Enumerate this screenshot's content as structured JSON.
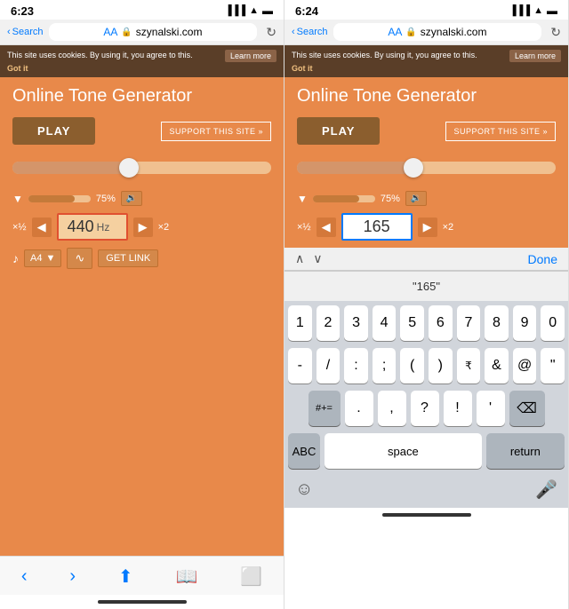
{
  "left_panel": {
    "time": "6:23",
    "back_label": "Search",
    "aa_label": "AA",
    "url": "szynalski.com",
    "cookie_text": "This site uses cookies. By using it, you agree to this.",
    "cookie_learn": "Learn more",
    "cookie_got": "Got it",
    "page_title": "Online Tone Generator",
    "play_label": "PLAY",
    "support_label": "SUPPORT THIS SITE »",
    "volume_pct": "75%",
    "freq_value": "440",
    "freq_unit": "Hz",
    "freq_half": "×½",
    "freq_double": "×2",
    "note_label": "A4",
    "get_link_label": "GET LINK"
  },
  "right_panel": {
    "time": "6:24",
    "back_label": "Search",
    "aa_label": "AA",
    "url": "szynalski.com",
    "cookie_text": "This site uses cookies. By using it, you agree to this.",
    "cookie_learn": "Learn more",
    "cookie_got": "Got it",
    "page_title": "Online Tone Generator",
    "play_label": "PLAY",
    "support_label": "SUPPORT THIS SITE »",
    "volume_pct": "75%",
    "freq_value": "165",
    "suggestion": "\"165\"",
    "done_label": "Done",
    "keyboard_rows": [
      [
        "1",
        "2",
        "3",
        "4",
        "5",
        "6",
        "7",
        "8",
        "9",
        "0"
      ],
      [
        "-",
        "/",
        ":",
        ";",
        "(",
        ")",
        "₹",
        "&",
        "@",
        "\""
      ],
      [
        "#+=",
        ".",
        ",",
        "?",
        "!",
        "'",
        "⌫"
      ],
      [
        "ABC",
        "space",
        "return"
      ]
    ]
  }
}
